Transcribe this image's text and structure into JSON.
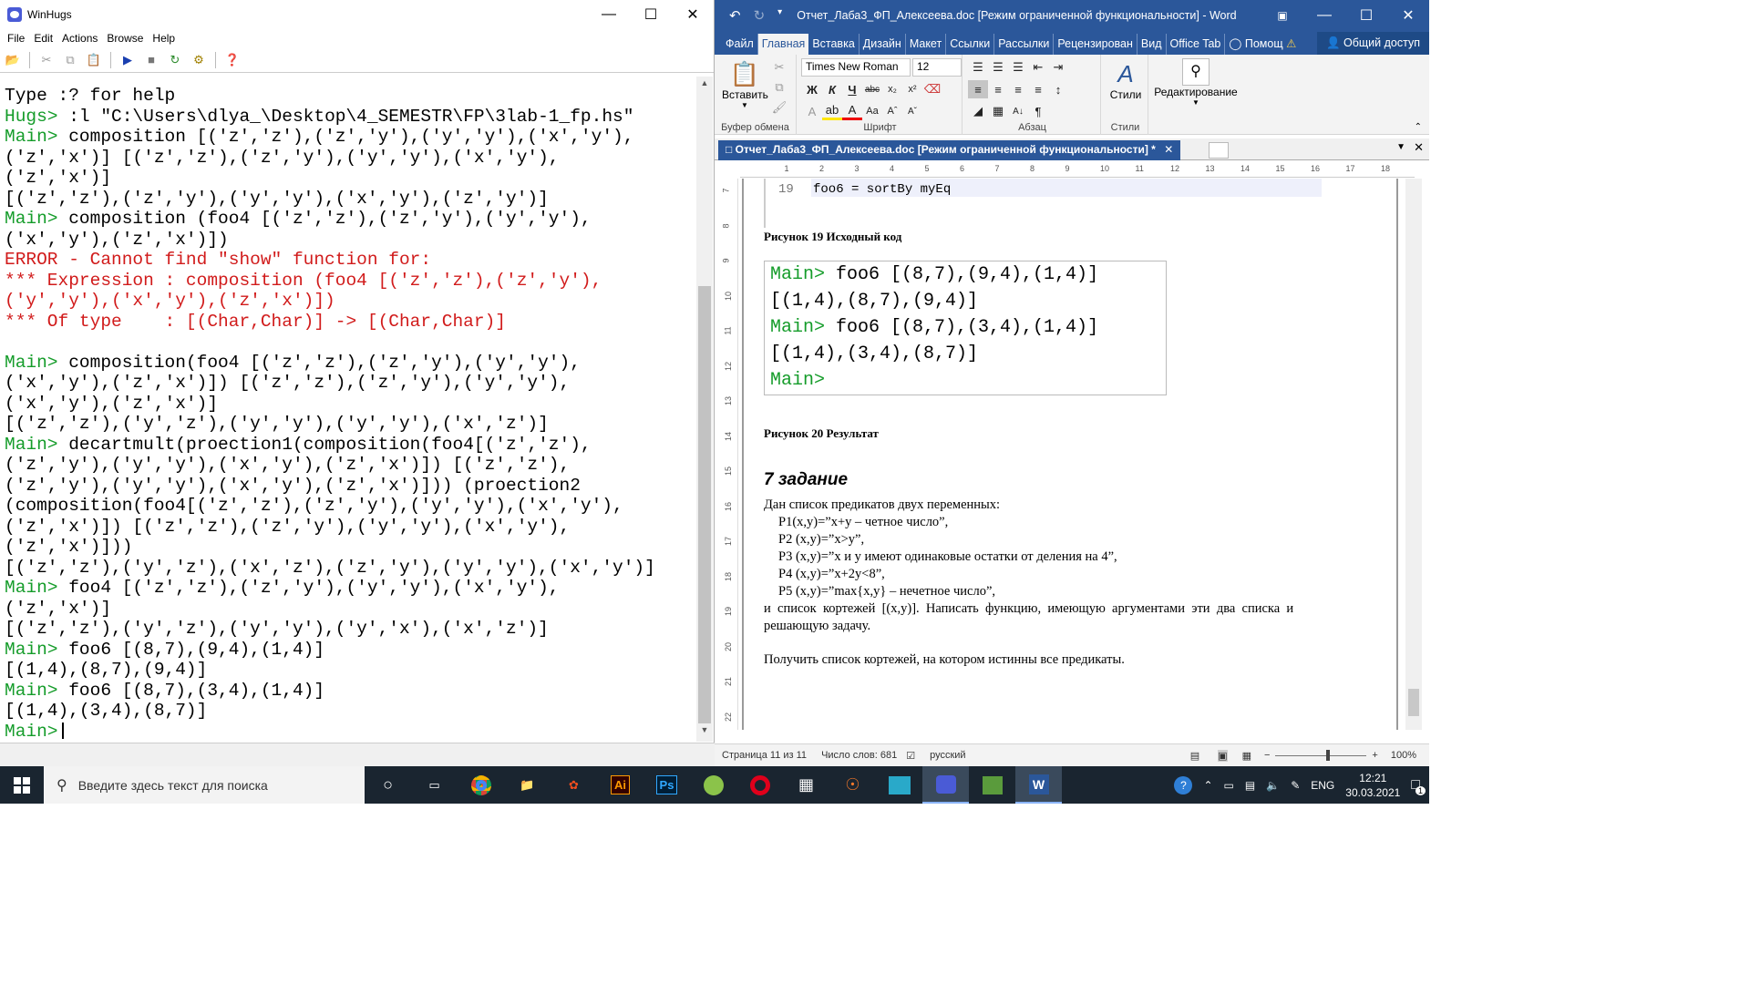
{
  "hugs": {
    "title": "WinHugs",
    "menu": [
      "File",
      "Edit",
      "Actions",
      "Browse",
      "Help"
    ],
    "lines": [
      {
        "type": "text",
        "text": "Type :? for help"
      },
      {
        "type": "prompt",
        "prompt": "Hugs>",
        "text": " :l \"C:\\Users\\dlya_\\Desktop\\4_SEMESTR\\FP\\3lab-1_fp.hs\""
      },
      {
        "type": "prompt",
        "prompt": "Main>",
        "text": " composition [('z','z'),('z','y'),('y','y'),('x','y'),"
      },
      {
        "type": "text",
        "text": "('z','x')] [('z','z'),('z','y'),('y','y'),('x','y'),"
      },
      {
        "type": "text",
        "text": "('z','x')]"
      },
      {
        "type": "text",
        "text": "[('z','z'),('z','y'),('y','y'),('x','y'),('z','y')]"
      },
      {
        "type": "prompt",
        "prompt": "Main>",
        "text": " composition (foo4 [('z','z'),('z','y'),('y','y'),"
      },
      {
        "type": "text",
        "text": "('x','y'),('z','x')])"
      },
      {
        "type": "error",
        "text": "ERROR - Cannot find \"show\" function for:"
      },
      {
        "type": "error",
        "text": "*** Expression : composition (foo4 [('z','z'),('z','y'),"
      },
      {
        "type": "error",
        "text": "('y','y'),('x','y'),('z','x')])"
      },
      {
        "type": "error",
        "text": "*** Of type    : [(Char,Char)] -> [(Char,Char)]"
      },
      {
        "type": "text",
        "text": ""
      },
      {
        "type": "prompt",
        "prompt": "Main>",
        "text": " composition(foo4 [('z','z'),('z','y'),('y','y'),"
      },
      {
        "type": "text",
        "text": "('x','y'),('z','x')]) [('z','z'),('z','y'),('y','y'),"
      },
      {
        "type": "text",
        "text": "('x','y'),('z','x')]"
      },
      {
        "type": "text",
        "text": "[('z','z'),('y','z'),('y','y'),('y','y'),('x','z')]"
      },
      {
        "type": "prompt",
        "prompt": "Main>",
        "text": " decartmult(proection1(composition(foo4[('z','z'),"
      },
      {
        "type": "text",
        "text": "('z','y'),('y','y'),('x','y'),('z','x')]) [('z','z'),"
      },
      {
        "type": "text",
        "text": "('z','y'),('y','y'),('x','y'),('z','x')])) (proection2"
      },
      {
        "type": "text",
        "text": "(composition(foo4[('z','z'),('z','y'),('y','y'),('x','y'),"
      },
      {
        "type": "text",
        "text": "('z','x')]) [('z','z'),('z','y'),('y','y'),('x','y'),"
      },
      {
        "type": "text",
        "text": "('z','x')]))"
      },
      {
        "type": "text",
        "text": "[('z','z'),('y','z'),('x','z'),('z','y'),('y','y'),('x','y')]"
      },
      {
        "type": "prompt",
        "prompt": "Main>",
        "text": " foo4 [('z','z'),('z','y'),('y','y'),('x','y'),"
      },
      {
        "type": "text",
        "text": "('z','x')]"
      },
      {
        "type": "text",
        "text": "[('z','z'),('y','z'),('y','y'),('y','x'),('x','z')]"
      },
      {
        "type": "prompt",
        "prompt": "Main>",
        "text": " foo6 [(8,7),(9,4),(1,4)]"
      },
      {
        "type": "text",
        "text": "[(1,4),(8,7),(9,4)]"
      },
      {
        "type": "prompt",
        "prompt": "Main>",
        "text": " foo6 [(8,7),(3,4),(1,4)]"
      },
      {
        "type": "text",
        "text": "[(1,4),(3,4),(8,7)]"
      },
      {
        "type": "prompt",
        "prompt": "Main>",
        "text": ""
      }
    ]
  },
  "word": {
    "title": "Отчет_Лаба3_ФП_Алексеева.doc [Режим ограниченной функциональности] - Word",
    "tabs": [
      "Файл",
      "Главная",
      "Вставка",
      "Дизайн",
      "Макет",
      "Ссылки",
      "Рассылки",
      "Рецензирован",
      "Вид",
      "Office Tab",
      "Помощ"
    ],
    "share": "Общий доступ",
    "ribbon": {
      "paste": "Вставить",
      "clipboard": "Буфер обмена",
      "font_name": "Times New Roman",
      "font_size": "12",
      "font_group": "Шрифт",
      "paragraph_group": "Абзац",
      "styles": "Стили",
      "styles_group": "Стили",
      "editing": "Редактирование"
    },
    "doc_tab": "Отчет_Лаба3_ФП_Алексеева.doc [Режим ограниченной функциональности] *",
    "code_line_number": "19",
    "code_line": "foo6 = sortBy myEq",
    "caption19": "Рисунок 19 Исходный код",
    "shot_lines": [
      {
        "prompt": "Main>",
        "text": " foo6 [(8,7),(9,4),(1,4)]"
      },
      {
        "prompt": "",
        "text": "[(1,4),(8,7),(9,4)]"
      },
      {
        "prompt": "Main>",
        "text": " foo6 [(8,7),(3,4),(1,4)]"
      },
      {
        "prompt": "",
        "text": "[(1,4),(3,4),(8,7)]"
      },
      {
        "prompt": "Main>",
        "text": ""
      }
    ],
    "caption20": "Рисунок 20 Результат",
    "task_title": "7 задание",
    "intro": "Дан список предикатов двух переменных:",
    "p1": "P1(x,y)=”x+y – четное число”,",
    "p2": "P2 (x,y)=”x>y”,",
    "p3": "P3 (x,y)=”x и y имеют одинаковые остатки от деления на 4”,",
    "p4": "P4 (x,y)=”x+2y<8”,",
    "p5": "P5 (x,y)=”max{x,y} – нечетное число”,",
    "para1": "и  список  кортежей  [(x,y)].  Написать  функцию,  имеющую  аргументами  эти  два  списка  и",
    "para2": "решающую задачу.",
    "para3": "Получить список кортежей, на котором истинны все предикаты.",
    "status": {
      "page": "Страница 11 из 11",
      "words": "Число слов: 681",
      "lang": "русский",
      "zoom": "100%"
    }
  },
  "taskbar": {
    "search_placeholder": "Введите здесь текст для поиска",
    "lang": "ENG",
    "time": "12:21",
    "date": "30.03.2021",
    "notifications": "1"
  },
  "colors": {
    "prompt": "#159c2a",
    "error": "#d11b1b",
    "word_blue": "#2b579a"
  }
}
